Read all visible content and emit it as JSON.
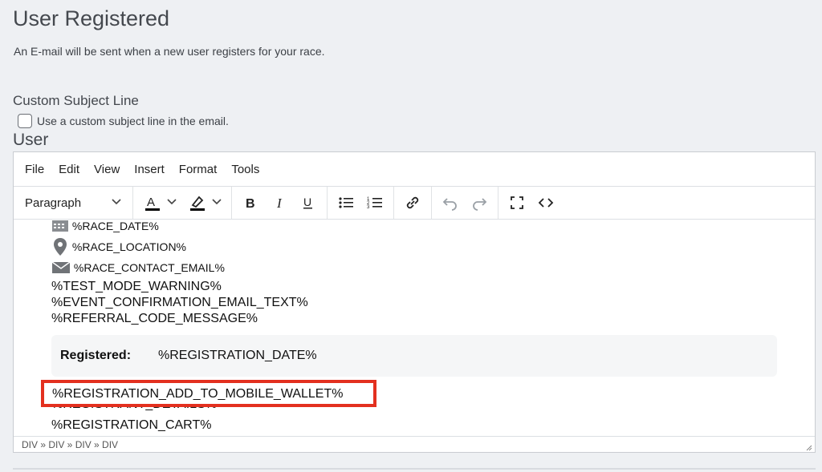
{
  "page": {
    "title": "User Registered",
    "description": "An E-mail will be sent when a new user registers for your race."
  },
  "subject": {
    "section_label": "Custom Subject Line",
    "checkbox_label": "Use a custom subject line in the email.",
    "checked": false
  },
  "editor": {
    "label": "User",
    "menu": [
      "File",
      "Edit",
      "View",
      "Insert",
      "Format",
      "Tools"
    ],
    "toolbar": {
      "block_format": "Paragraph",
      "icons": [
        "text-color-icon",
        "highlight-icon",
        "bold-icon",
        "italic-icon",
        "underline-icon",
        "bullet-list-icon",
        "numbered-list-icon",
        "link-icon",
        "undo-icon",
        "redo-icon",
        "fullscreen-icon",
        "source-code-icon"
      ]
    },
    "content": {
      "race_date": "%RACE_DATE%",
      "race_location": "%RACE_LOCATION%",
      "race_contact_email": "%RACE_CONTACT_EMAIL%",
      "test_mode_warning": "%TEST_MODE_WARNING%",
      "event_confirmation": "%EVENT_CONFIRMATION_EMAIL_TEXT%",
      "referral_code": "%REFERRAL_CODE_MESSAGE%",
      "registered_label": "Registered:",
      "registration_date": "%REGISTRATION_DATE%",
      "mobile_wallet": "%REGISTRATION_ADD_TO_MOBILE_WALLET%",
      "registrant_details": "%REGISTRANT_DETAILS%",
      "registration_cart": "%REGISTRATION_CART%"
    },
    "status_path": "DIV » DIV » DIV » DIV"
  },
  "colors": {
    "highlight_border": "#e3301f",
    "background": "#eef0f3"
  }
}
